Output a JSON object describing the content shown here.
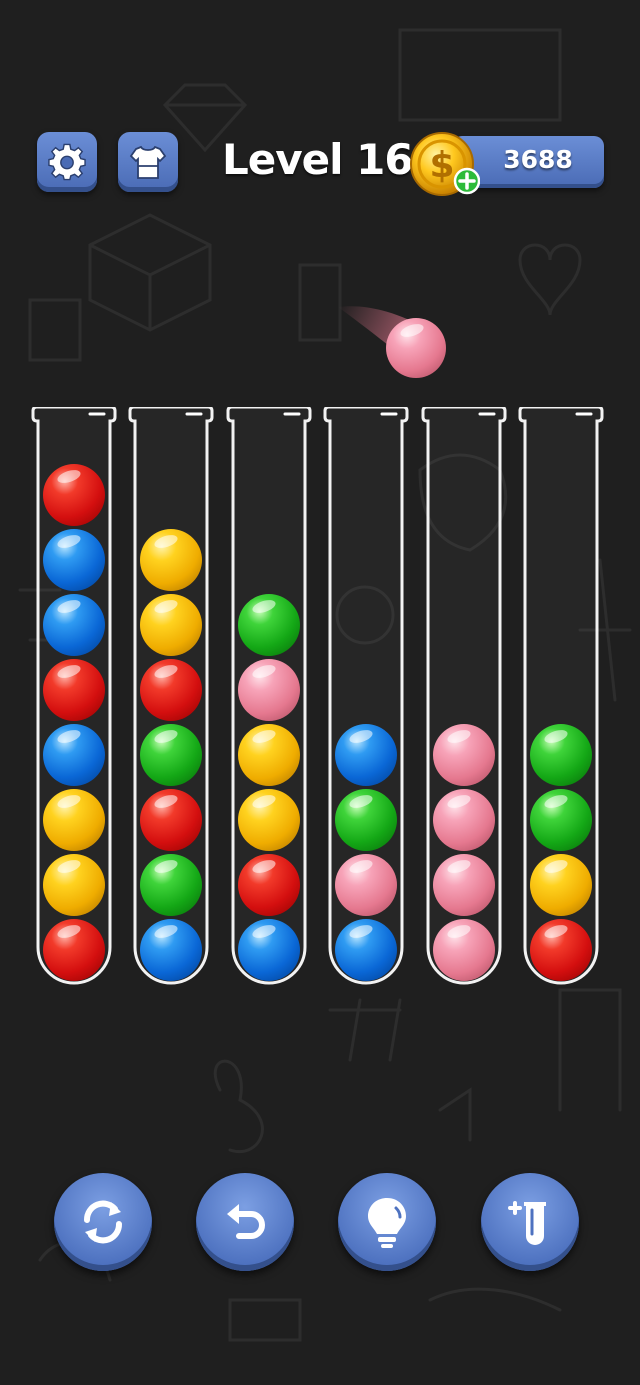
{
  "level": {
    "title": "Level 16"
  },
  "coins": {
    "count": "3688"
  },
  "colors": {
    "background": "#1f1f1f",
    "button_blue": "#5a7dc8",
    "red": "#d40f0f",
    "blue": "#0a67d6",
    "yellow": "#efac00",
    "green": "#14a816",
    "pink": "#e5788f"
  },
  "top_bar": {
    "settings_icon": "gear-icon",
    "skin_icon": "shirt-icon",
    "coin_icon": "dollar-coin-icon",
    "coin_add_icon": "plus-icon"
  },
  "tubes": [
    {
      "balls_bottom_to_top": [
        "red",
        "yellow",
        "yellow",
        "blue",
        "red",
        "blue",
        "blue",
        "red"
      ]
    },
    {
      "balls_bottom_to_top": [
        "blue",
        "green",
        "red",
        "green",
        "red",
        "yellow",
        "yellow"
      ]
    },
    {
      "balls_bottom_to_top": [
        "blue",
        "red",
        "yellow",
        "yellow",
        "pink",
        "green"
      ]
    },
    {
      "balls_bottom_to_top": [
        "blue",
        "pink",
        "green",
        "blue"
      ]
    },
    {
      "balls_bottom_to_top": [
        "pink",
        "pink",
        "pink",
        "pink"
      ]
    },
    {
      "balls_bottom_to_top": [
        "red",
        "yellow",
        "green",
        "green"
      ]
    }
  ],
  "held_ball": {
    "color": "pink"
  },
  "bottom_buttons": [
    {
      "icon": "restart-icon"
    },
    {
      "icon": "undo-icon"
    },
    {
      "icon": "hint-bulb-icon"
    },
    {
      "icon": "add-tube-icon"
    }
  ]
}
